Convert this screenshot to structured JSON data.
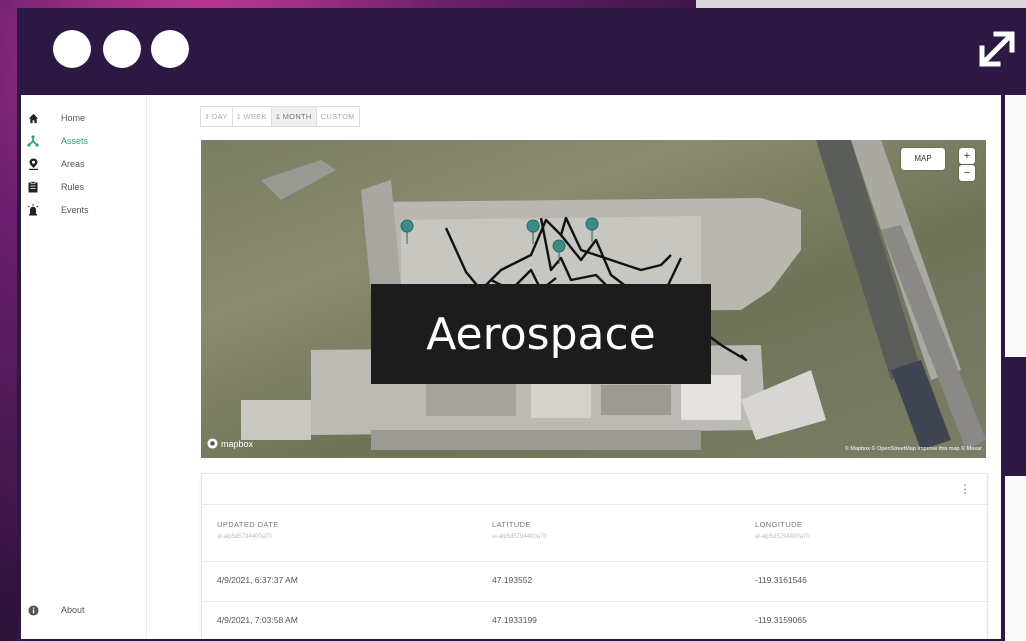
{
  "window": {
    "title_dots": [
      "dot",
      "dot",
      "dot"
    ],
    "expand_icon": "expand-arrows-icon",
    "frame_color": "#2c1843"
  },
  "sidebar": {
    "items": [
      {
        "label": "Home",
        "icon": "home-icon",
        "active": false
      },
      {
        "label": "Assets",
        "icon": "assets-icon",
        "active": true
      },
      {
        "label": "Areas",
        "icon": "location-pin-icon",
        "active": false
      },
      {
        "label": "Rules",
        "icon": "clipboard-icon",
        "active": false
      },
      {
        "label": "Events",
        "icon": "alarm-icon",
        "active": false
      }
    ],
    "footer": {
      "label": "About",
      "icon": "info-icon"
    },
    "accent": "#2e9e7e"
  },
  "time_filter": {
    "options": [
      "1 DAY",
      "1 WEEK",
      "1 MONTH",
      "CUSTOM"
    ],
    "selected": "1 MONTH"
  },
  "map": {
    "style_button": "MAP",
    "zoom_in": "+",
    "zoom_out": "−",
    "logo": "mapbox",
    "attribution": "© Mapbox © OpenStreetMap Improve this map © Maxar",
    "overlay_label": "Aerospace"
  },
  "table": {
    "columns": [
      {
        "title": "UPDATED DATE",
        "subtitle": "ai-alp5d5794400a70"
      },
      {
        "title": "LATITUDE",
        "subtitle": "ai-alp5d5794400a70"
      },
      {
        "title": "LONGITUDE",
        "subtitle": "ai-alp5d5794400a70"
      }
    ],
    "rows": [
      [
        "4/9/2021, 6:37:37 AM",
        "47.193552",
        "-119.3161546"
      ],
      [
        "4/9/2021, 7:03:58 AM",
        "47.1933199",
        "-119.3159065"
      ]
    ]
  }
}
